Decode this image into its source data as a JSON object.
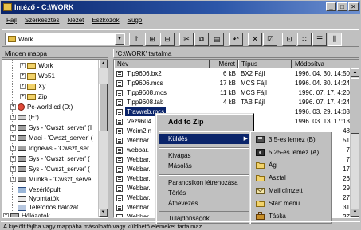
{
  "window": {
    "title": "Intéző - C:\\WORK",
    "controls": [
      "_",
      "□",
      "✕"
    ]
  },
  "menubar": [
    "Fájl",
    "Szerkesztés",
    "Nézet",
    "Eszközök",
    "Súgó"
  ],
  "toolbar": {
    "address_value": "Work"
  },
  "tree": {
    "header": "Minden mappa",
    "items": [
      {
        "label": "Work",
        "icon": "folder-icon"
      },
      {
        "label": "Wp51",
        "icon": "folder-icon"
      },
      {
        "label": "Xy",
        "icon": "folder-icon"
      },
      {
        "label": "Zip",
        "icon": "folder-icon"
      },
      {
        "label": "Pc-world cd (D:)",
        "icon": "cd-drive-icon"
      },
      {
        "label": "(E:)",
        "icon": "drive-icon"
      },
      {
        "label": "Sys - 'Cwszt_server' (I",
        "icon": "network-drive-icon"
      },
      {
        "label": "Maci - 'Cwszt_server' (",
        "icon": "network-drive-icon"
      },
      {
        "label": "Idgnews - 'Cwszt_ser",
        "icon": "network-drive-icon"
      },
      {
        "label": "Sys - 'Cwszt_server' (",
        "icon": "network-drive-icon"
      },
      {
        "label": "Sys - 'Cwszt_server' (",
        "icon": "network-drive-icon"
      },
      {
        "label": "Munka - 'Cwszt_serve",
        "icon": "network-drive-icon"
      },
      {
        "label": "Vezérlőpult",
        "icon": "control-panel-icon"
      },
      {
        "label": "Nyomtatók",
        "icon": "printer-icon"
      },
      {
        "label": "Telefonos hálózat",
        "icon": "dialup-icon"
      },
      {
        "label": "Hálózatok",
        "icon": "network-icon"
      }
    ]
  },
  "list": {
    "header": "'C:\\WORK' tartalma",
    "columns": [
      "Név",
      "Méret",
      "Típus",
      "Módosítva"
    ],
    "rows": [
      {
        "name": "Tip9606.bx2",
        "size": "6 kB",
        "type": "BX2 Fájl",
        "modified": "1996. 04. 30. 14:50"
      },
      {
        "name": "Tip9606.mcs",
        "size": "17 kB",
        "type": "MCS Fájl",
        "modified": "1996. 04. 30. 14:24"
      },
      {
        "name": "Tipp9608.mcs",
        "size": "11 kB",
        "type": "MCS Fájl",
        "modified": "1996. 07. 17. 4:20"
      },
      {
        "name": "Tipp9608.tab",
        "size": "4 kB",
        "type": "TAB Fájl",
        "modified": "1996. 07. 17. 4:24"
      },
      {
        "name": "Travweb.mcs",
        "size": "",
        "type": "",
        "modified": "1996. 03. 29. 14:03"
      },
      {
        "name": "Vez9604",
        "size": "",
        "type": "",
        "modified": "1996. 03. 13. 17:13"
      },
      {
        "name": "Wcim2.n",
        "size": "",
        "type": "",
        "modified": "48"
      },
      {
        "name": "Webbar.",
        "size": "",
        "type": "",
        "modified": "51"
      },
      {
        "name": "webbar.",
        "size": "",
        "type": "",
        "modified": "7"
      },
      {
        "name": "Webbar.",
        "size": "",
        "type": "",
        "modified": "7"
      },
      {
        "name": "Webbar.",
        "size": "",
        "type": "",
        "modified": "17"
      },
      {
        "name": "Webbar.",
        "size": "",
        "type": "",
        "modified": "26"
      },
      {
        "name": "Webbar.",
        "size": "",
        "type": "",
        "modified": "29"
      },
      {
        "name": "Webbar.",
        "size": "",
        "type": "",
        "modified": "27"
      },
      {
        "name": "Webbar.",
        "size": "",
        "type": "",
        "modified": "31"
      },
      {
        "name": "Webbar.",
        "size": "",
        "type": "",
        "modified": "37"
      }
    ]
  },
  "context_menu": {
    "items": [
      "Add to Zip",
      "Küldés",
      "Kivágás",
      "Másolás",
      "Parancsikon létrehozása",
      "Törlés",
      "Átnevezés",
      "Tulajdonságok"
    ]
  },
  "send_to_menu": {
    "items": [
      {
        "label": "3,5-es lemez (B)",
        "icon": "floppy-icon"
      },
      {
        "label": "5,25-es lemez (A)",
        "icon": "floppy-icon"
      },
      {
        "label": "Ági",
        "icon": "folder-icon"
      },
      {
        "label": "Asztal",
        "icon": "desktop-folder-icon"
      },
      {
        "label": "Mail címzett",
        "icon": "mail-icon"
      },
      {
        "label": "Start menü",
        "icon": "start-menu-icon"
      },
      {
        "label": "Táska",
        "icon": "briefcase-icon"
      }
    ]
  },
  "statusbar": {
    "text": "A kijelölt fájlba vagy mappába másolható vagy küldhető elemeket tartalmaz."
  },
  "colors": {
    "titlebar": "#0a246a",
    "selection": "#0a246a",
    "face": "#c0c0c0"
  }
}
